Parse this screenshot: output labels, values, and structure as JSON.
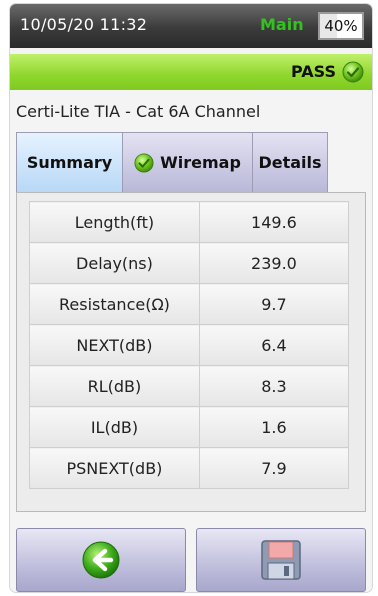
{
  "status_bar": {
    "datetime": "10/05/20 11:32",
    "mode": "Main",
    "battery_percent": 40,
    "battery_label": "40%"
  },
  "result": {
    "label": "PASS",
    "icon": "pass-check-icon",
    "color": "#8fd62d"
  },
  "test_title": "Certi-Lite TIA - Cat 6A Channel",
  "tabs": [
    {
      "label": "Summary",
      "active": true
    },
    {
      "label": "Wiremap",
      "icon": "pass-check-icon",
      "active": false
    },
    {
      "label": "Details",
      "active": false
    }
  ],
  "results_table": [
    {
      "name": "Length(ft)",
      "value": "149.6"
    },
    {
      "name": "Delay(ns)",
      "value": "239.0"
    },
    {
      "name": "Resistance(Ω)",
      "value": "9.7"
    },
    {
      "name": "NEXT(dB)",
      "value": "6.4"
    },
    {
      "name": "RL(dB)",
      "value": "8.3"
    },
    {
      "name": "IL(dB)",
      "value": "1.6"
    },
    {
      "name": "PSNEXT(dB)",
      "value": "7.9"
    }
  ],
  "buttons": {
    "back_icon": "back-arrow-icon",
    "save_icon": "save-disk-icon"
  },
  "colors": {
    "pass_green": "#8fd62d",
    "main_text": "#33c11f",
    "tab_active": "#b8d8f6",
    "tab_inactive": "#b9b8d8"
  }
}
